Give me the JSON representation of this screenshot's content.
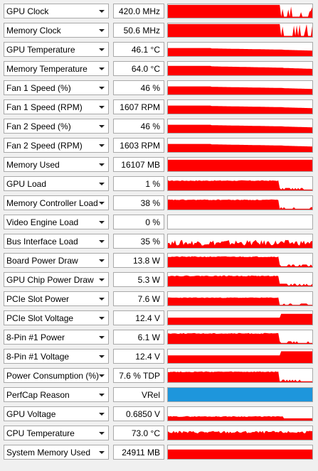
{
  "colors": {
    "graph": "#ff0000",
    "perfcap": "#1e96dc"
  },
  "icons": {
    "dropdown": "chevron-down-icon"
  },
  "sensors": [
    {
      "name": "GPU Clock",
      "value": "420.0 MHz",
      "shape": "spiky",
      "level": 0.95
    },
    {
      "name": "Memory Clock",
      "value": "50.6 MHz",
      "shape": "spiky",
      "level": 0.95
    },
    {
      "name": "GPU Temperature",
      "value": "46.1 °C",
      "shape": "decay",
      "level": 0.6
    },
    {
      "name": "Memory Temperature",
      "value": "64.0 °C",
      "shape": "decay",
      "level": 0.7
    },
    {
      "name": "Fan 1 Speed (%)",
      "value": "46 %",
      "shape": "decay",
      "level": 0.6
    },
    {
      "name": "Fan 1 Speed (RPM)",
      "value": "1607 RPM",
      "shape": "decay",
      "level": 0.6
    },
    {
      "name": "Fan 2 Speed (%)",
      "value": "46 %",
      "shape": "decay",
      "level": 0.6
    },
    {
      "name": "Fan 2 Speed (RPM)",
      "value": "1603 RPM",
      "shape": "decay",
      "level": 0.6
    },
    {
      "name": "Memory Used",
      "value": "16107 MB",
      "shape": "full",
      "level": 0.85
    },
    {
      "name": "GPU Load",
      "value": "1 %",
      "shape": "drop",
      "level": 0.75
    },
    {
      "name": "Memory Controller Load",
      "value": "38 %",
      "shape": "drop",
      "level": 0.75
    },
    {
      "name": "Video Engine Load",
      "value": "0 %",
      "shape": "empty",
      "level": 0
    },
    {
      "name": "Bus Interface Load",
      "value": "35 %",
      "shape": "noisy",
      "level": 0.35
    },
    {
      "name": "Board Power Draw",
      "value": "13.8 W",
      "shape": "drop",
      "level": 0.8
    },
    {
      "name": "GPU Chip Power Draw",
      "value": "5.3 W",
      "shape": "drop",
      "level": 0.8
    },
    {
      "name": "PCIe Slot Power",
      "value": "7.6 W",
      "shape": "drop",
      "level": 0.6
    },
    {
      "name": "PCIe Slot Voltage",
      "value": "12.4 V",
      "shape": "rise",
      "level": 0.55
    },
    {
      "name": "8-Pin #1 Power",
      "value": "6.1 W",
      "shape": "drop",
      "level": 0.8
    },
    {
      "name": "8-Pin #1 Voltage",
      "value": "12.4 V",
      "shape": "rise",
      "level": 0.6
    },
    {
      "name": "Power Consumption (%)",
      "value": "7.6 % TDP",
      "shape": "drop",
      "level": 0.8
    },
    {
      "name": "PerfCap Reason",
      "value": "VRel",
      "shape": "solidblue",
      "level": 1
    },
    {
      "name": "GPU Voltage",
      "value": "0.6850 V",
      "shape": "low",
      "level": 0.3
    },
    {
      "name": "CPU Temperature",
      "value": "73.0 °C",
      "shape": "noisyhigh",
      "level": 0.55
    },
    {
      "name": "System Memory Used",
      "value": "24911 MB",
      "shape": "full",
      "level": 0.7
    }
  ]
}
